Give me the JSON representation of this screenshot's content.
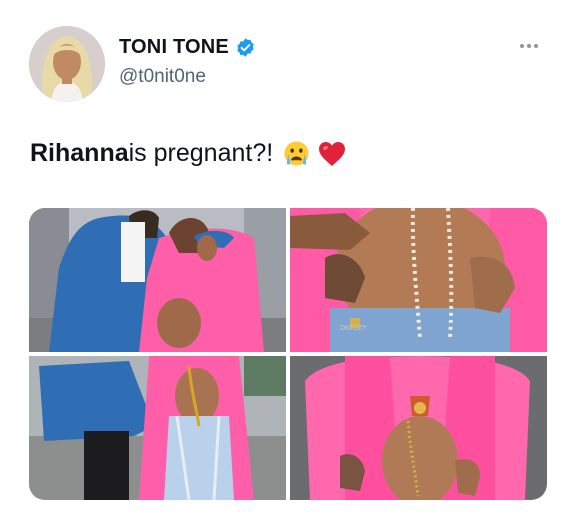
{
  "author": {
    "display_name": "TONI TONE",
    "handle": "@t0nit0ne",
    "verified": true
  },
  "icons": {
    "verified_badge": "verified-badge-icon",
    "more": "more-options-icon",
    "emoji_1": "crying-face-emoji",
    "emoji_2": "red-heart-emoji"
  },
  "tweet": {
    "bold_text": "Rihanna",
    "text": " is pregnant?!"
  },
  "media": {
    "watermark": "DIGGZY"
  },
  "colors": {
    "verified_blue": "#1d9bf0",
    "text_primary": "#0f1419",
    "text_secondary": "#536471",
    "coat_pink": "#ff5fa8",
    "denim_blue": "#2f6db5"
  }
}
